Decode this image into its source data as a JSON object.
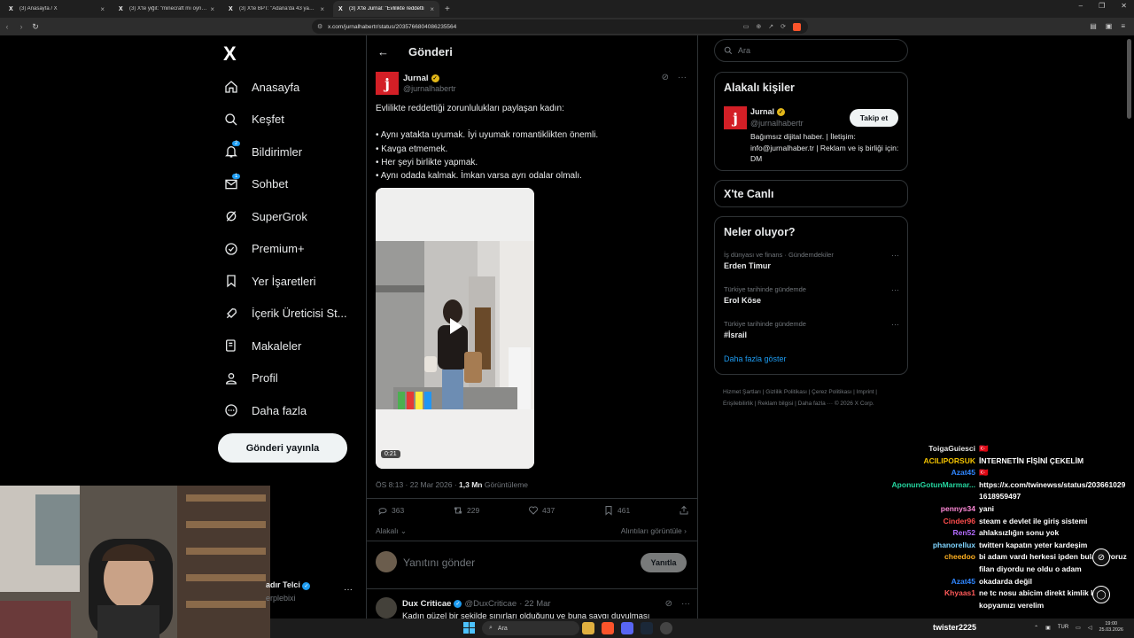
{
  "browser": {
    "tabs": [
      {
        "label": "(3) Anasayfa / X",
        "active": false
      },
      {
        "label": "(3) X'te yiğit: \"minecraft mı oynuyon",
        "active": false
      },
      {
        "label": "(3) X'te BPT: \"Adana'da 43 yaşındaki",
        "active": false
      },
      {
        "label": "(3) X'te Jurnal: \"Evlilikte reddetti",
        "active": true
      }
    ],
    "url": "x.com/jurnalhabertr/status/2035766804086235564"
  },
  "sidebar": {
    "logo": "X",
    "items": [
      {
        "label": "Anasayfa",
        "icon": "home-icon"
      },
      {
        "label": "Keşfet",
        "icon": "search-icon"
      },
      {
        "label": "Bildirimler",
        "icon": "bell-icon",
        "badge": "2"
      },
      {
        "label": "Sohbet",
        "icon": "mail-icon",
        "badge": "1"
      },
      {
        "label": "SuperGrok",
        "icon": "grok-icon"
      },
      {
        "label": "Premium+",
        "icon": "premium-icon"
      },
      {
        "label": "Yer İşaretleri",
        "icon": "bookmark-icon"
      },
      {
        "label": "İçerik Üreticisi St...",
        "icon": "rocket-icon"
      },
      {
        "label": "Makaleler",
        "icon": "article-icon"
      },
      {
        "label": "Profil",
        "icon": "person-icon"
      },
      {
        "label": "Daha fazla",
        "icon": "more-circle-icon"
      }
    ],
    "post_button": "Gönderi yayınla",
    "profile_name": "adır Telci",
    "profile_handle": "erplebixi"
  },
  "main": {
    "header_title": "Gönderi",
    "tweet": {
      "author": "Jurnal",
      "handle": "@jurnalhabertr",
      "avatar_letter": "j",
      "text": "Evlilikte reddettiği zorunlulukları paylaşan kadın:\n\n• Aynı yatakta uyumak. İyi uyumak romantiklikten önemli.\n• Kavga etmemek.\n• Her şeyi birlikte yapmak.\n• Aynı odada kalmak. İmkan varsa ayrı odalar olmalı.",
      "video_duration": "0:21",
      "time": "ÖS 8:13 · 22 Mar 2026 ·",
      "views": "1,3 Mn",
      "views_label": "Görüntüleme",
      "replies": "363",
      "retweets": "229",
      "likes": "437",
      "bookmarks": "461",
      "relevant_label": "Alakalı",
      "quotes_label": "Alıntıları görüntüle"
    },
    "reply_placeholder": "Yanıtını gönder",
    "reply_button": "Yanıtla",
    "reply2": {
      "author": "Dux Criticae",
      "handle": "@DuxCriticae",
      "date": "· 22 Mar",
      "text": "Kadın güzel bir şekilde sınırları olduğunu ve buna saygı duyulması"
    }
  },
  "right": {
    "search_placeholder": "Ara",
    "related_title": "Alakalı kişiler",
    "related_person": {
      "name": "Jurnal",
      "handle": "@jurnalhabertr",
      "follow": "Takip et",
      "bio": "Bağımsız dijital haber. | İletişim: info@jurnalhaber.tr | Reklam ve iş birliği için: DM"
    },
    "live_title": "X'te Canlı",
    "trends_title": "Neler oluyor?",
    "trends": [
      {
        "category": "İş dünyası ve finans · Gündemdekiler",
        "name": "Erden Timur"
      },
      {
        "category": "Türkiye tarihinde gündemde",
        "name": "Erol Köse"
      },
      {
        "category": "Türkiye tarihinde gündemde",
        "name": "#İsrail"
      }
    ],
    "show_more": "Daha fazla göster",
    "footer": "Hizmet Şartları  |  Gizlilik Politikası  |  Çerez Politikası  |  Imprint  |  Erişilebilirlik  |  Reklam bilgisi  |  Daha fazla ···  © 2026 X Corp."
  },
  "chat": [
    {
      "user": "ToigaGuiesci",
      "color": "#e6e6e6",
      "msg": "🇹🇷"
    },
    {
      "user": "ACILIPORSUK",
      "color": "#f2c200",
      "msg": "İNTERNETİN FİŞİNİ ÇEKELİM"
    },
    {
      "user": "Azat45",
      "color": "#2f86ff",
      "msg": "🇹🇷"
    },
    {
      "user": "AponunGotunMarmar...",
      "color": "#25d6a0",
      "msg": "https://x.com/twinewss/status/2036610291618959497"
    },
    {
      "user": "pennys34",
      "color": "#ff8ad8",
      "msg": "yani"
    },
    {
      "user": "Cinder96",
      "color": "#ff4d4d",
      "msg": "steam e devlet ile giriş sistemi"
    },
    {
      "user": "Ren52",
      "color": "#b36bff",
      "msg": "ahlaksızlığın sonu yok"
    },
    {
      "user": "phanorellux",
      "color": "#7fd4ff",
      "msg": "twitterı kapatın yeter kardeşim"
    },
    {
      "user": "cheedoo",
      "color": "#ffb020",
      "msg": "bi adam vardı herkesi ipden bulabiliyoruz filan diyordu ne oldu o adam"
    },
    {
      "user": "Azat45",
      "color": "#2f86ff",
      "msg": "okadarda değil"
    },
    {
      "user": "Khyaas1",
      "color": "#ff5a5a",
      "msg": "ne tc nosu abicim direkt kimlik kar kopyamızı verelim"
    }
  ],
  "taskbar": {
    "search": "Ara",
    "username": "twister2225",
    "lang": "TUR",
    "time": "19:00",
    "date": "25.03.2026"
  }
}
